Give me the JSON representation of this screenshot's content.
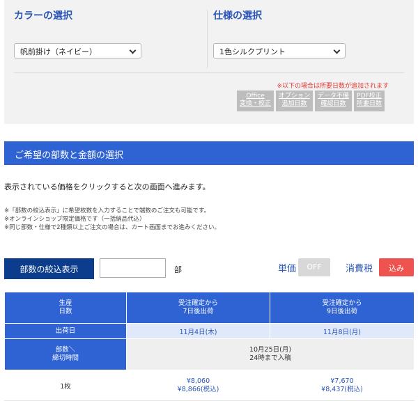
{
  "color_section": {
    "title": "カラーの選択",
    "selected": "帆前掛け（ネイビー）"
  },
  "spec_section": {
    "title": "仕様の選択",
    "selected": "1色シルクプリント"
  },
  "notice": "※以下の場合は所要日数が追加されます",
  "option_buttons": [
    {
      "line1": "Office",
      "line2": "変換・校正"
    },
    {
      "line1": "オプション",
      "line2": "追加日数"
    },
    {
      "line1": "データ不備",
      "line2": "確認日数"
    },
    {
      "line1": "PDF校正",
      "line2": "所要日数"
    }
  ],
  "section_title": "ご希望の部数と金額の選択",
  "lead_text": "表示されている価格をクリックすると次の画面へ進みます。",
  "notes": [
    "※「部数の絞込表示」に希望枚数を入力することで端数のご注文も可能です。",
    "※オンラインショップ限定価格です（一括納品代込）",
    "※同じ部数・仕様で2種類以上ご注文の場合は、カート画面までお進みください。"
  ],
  "filter": {
    "label": "部数の絞込表示",
    "value": "",
    "unit": "部"
  },
  "unit_price": {
    "label": "単価",
    "state": "OFF"
  },
  "tax": {
    "label": "消費税",
    "state": "込み"
  },
  "table": {
    "header_production": {
      "line1": "生産",
      "line2": "日数"
    },
    "plans": [
      {
        "line1": "受注確定から",
        "line2": "7日後出荷",
        "ship_date": "11月4日(木)"
      },
      {
        "line1": "受注確定から",
        "line2": "9日後出荷",
        "ship_date": "11月8日(月)"
      }
    ],
    "ship_label": "出荷日",
    "cutoff_label": {
      "line1": "部数＼",
      "line2": "締切時間"
    },
    "cutoff_value": {
      "line1": "10月25日(月)",
      "line2": "24時まで入稿"
    },
    "rows": [
      {
        "qty": "1枚",
        "prices": [
          {
            "price": "¥8,060",
            "with_tax": "¥8,866(税込)"
          },
          {
            "price": "¥7,670",
            "with_tax": "¥8,437(税込)"
          }
        ]
      }
    ]
  },
  "colors": {
    "accent_blue": "#2f63d4",
    "dark_blue": "#0c3c8c",
    "notice_red": "#e53935",
    "toggle_red": "#ef5350"
  }
}
